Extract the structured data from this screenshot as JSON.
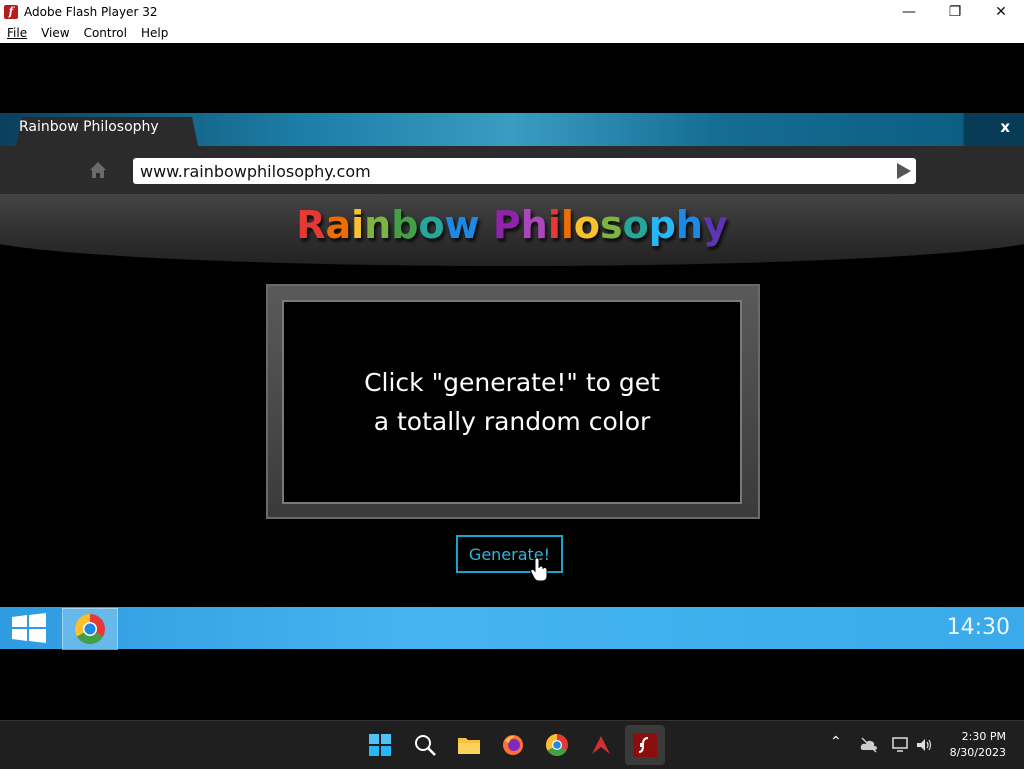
{
  "window": {
    "title": "Adobe Flash Player 32",
    "controls": {
      "minimize": "—",
      "maximize": "❐",
      "close": "✕"
    }
  },
  "menu": [
    "File",
    "View",
    "Control",
    "Help"
  ],
  "browser": {
    "tab_label": "Rainbow Philosophy",
    "close_label": "x",
    "url": "www.rainbowphilosophy.com"
  },
  "logo": {
    "letters": [
      {
        "ch": "R",
        "color": "#e53935"
      },
      {
        "ch": "a",
        "color": "#ef6c00"
      },
      {
        "ch": "i",
        "color": "#fbc02d"
      },
      {
        "ch": "n",
        "color": "#7cb342"
      },
      {
        "ch": "b",
        "color": "#43a047"
      },
      {
        "ch": "o",
        "color": "#26a69a"
      },
      {
        "ch": "w",
        "color": "#1e88e5"
      },
      {
        "ch": " ",
        "color": "#ffffff"
      },
      {
        "ch": "P",
        "color": "#8e24aa"
      },
      {
        "ch": "h",
        "color": "#ab47bc"
      },
      {
        "ch": "i",
        "color": "#e53935"
      },
      {
        "ch": "l",
        "color": "#ef6c00"
      },
      {
        "ch": "o",
        "color": "#fbc02d"
      },
      {
        "ch": "s",
        "color": "#7cb342"
      },
      {
        "ch": "o",
        "color": "#26a69a"
      },
      {
        "ch": "p",
        "color": "#29b6f6"
      },
      {
        "ch": "h",
        "color": "#1e88e5"
      },
      {
        "ch": "y",
        "color": "#5e35b1"
      }
    ]
  },
  "content": {
    "message": "Click \"generate!\" to get\na totally random color",
    "generate_button": "Generate!"
  },
  "game_taskbar": {
    "clock": "14:30"
  },
  "taskbar": {
    "time": "2:30 PM",
    "date": "8/30/2023",
    "icons": [
      "windows-start-icon",
      "search-icon",
      "file-explorer-icon",
      "firefox-icon",
      "chrome-icon",
      "acrobat-icon",
      "flash-player-icon"
    ]
  }
}
